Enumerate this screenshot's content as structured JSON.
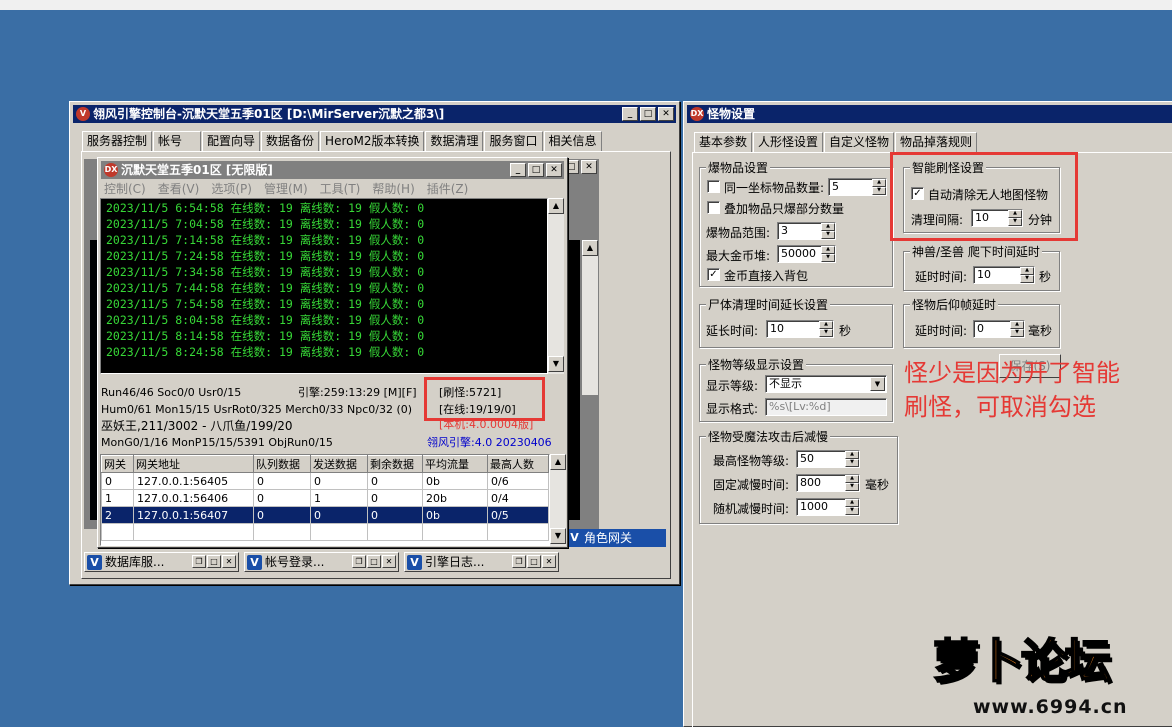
{
  "main_window": {
    "title": "翎风引擎控制台-沉默天堂五季01区 [D:\\MirServer沉默之都3\\]",
    "tabs": [
      "服务器控制",
      "帐号",
      "配置向导",
      "数据备份",
      "HeroM2版本转换",
      "数据清理",
      "服务窗口",
      "相关信息"
    ],
    "selected_tab": "服务窗口"
  },
  "server_window": {
    "title": "沉默天堂五季01区 [无限版]",
    "menu": [
      "控制(C)",
      "查看(V)",
      "选项(P)",
      "管理(M)",
      "工具(T)",
      "帮助(H)",
      "插件(Z)"
    ],
    "log_lines": [
      "2023/11/5 6:54:58 在线数: 19 离线数: 19 假人数: 0",
      "2023/11/5 7:04:58 在线数: 19 离线数: 19 假人数: 0",
      "2023/11/5 7:14:58 在线数: 19 离线数: 19 假人数: 0",
      "2023/11/5 7:24:58 在线数: 19 离线数: 19 假人数: 0",
      "2023/11/5 7:34:58 在线数: 19 离线数: 19 假人数: 0",
      "2023/11/5 7:44:58 在线数: 19 离线数: 19 假人数: 0",
      "2023/11/5 7:54:58 在线数: 19 离线数: 19 假人数: 0",
      "2023/11/5 8:04:58 在线数: 19 离线数: 19 假人数: 0",
      "2023/11/5 8:14:58 在线数: 19 离线数: 19 假人数: 0",
      "2023/11/5 8:24:58 在线数: 19 离线数: 19 假人数: 0"
    ],
    "status": {
      "line1_left": "Run46/46 Soc0/0 Usr0/15",
      "line1_mid": "引擎:259:13:29 [M][F]",
      "refresh": "[刷怪:5721]",
      "line2_left": "Hum0/61 Mon15/15 UsrRot0/325 Merch0/33 Npc0/32 (0)",
      "online": "[在线:19/19/0]",
      "line3_left": "巫妖王,211/3002 - 八爪鱼/199/20",
      "line3_right": "[本机:4.0.0004版]",
      "line4_left": "MonG0/1/16 MonP15/15/5391 ObjRun0/15",
      "version": "翎风引擎:4.0 20230406"
    },
    "gateway_table": {
      "headers": [
        "网关",
        "网关地址",
        "队列数据",
        "发送数据",
        "剩余数据",
        "平均流量",
        "最高人数"
      ],
      "rows": [
        [
          "0",
          "127.0.0.1:56405",
          "0",
          "0",
          "0",
          "0b",
          "0/6"
        ],
        [
          "1",
          "127.0.0.1:56406",
          "0",
          "1",
          "0",
          "20b",
          "0/4"
        ],
        [
          "2",
          "127.0.0.1:56407",
          "0",
          "0",
          "0",
          "0b",
          "0/5"
        ]
      ],
      "selected_row": 2
    }
  },
  "taskbar": {
    "items": [
      "数据库服...",
      "帐号登录...",
      "引擎日志..."
    ],
    "role_gateway": "角色网关"
  },
  "monster_settings": {
    "title": "怪物设置",
    "tabs": [
      "基本参数",
      "人形怪设置",
      "自定义怪物",
      "物品掉落规则"
    ],
    "selected_tab": "基本参数",
    "drop_group": {
      "label": "爆物品设置",
      "same_coord_label": "同一坐标物品数量:",
      "same_coord_checked": false,
      "same_coord_value": "5",
      "stack_only_label": "叠加物品只爆部分数量",
      "stack_only_checked": false,
      "range_label": "爆物品范围:",
      "range_value": "3",
      "max_gold_label": "最大金币堆:",
      "max_gold_value": "50000",
      "gold_to_bag_label": "金币直接入背包",
      "gold_to_bag_checked": true
    },
    "smart_refresh": {
      "label": "智能刷怪设置",
      "auto_clear_label": "自动清除无人地图怪物",
      "auto_clear_checked": true,
      "interval_label": "清理间隔:",
      "interval_value": "10",
      "interval_unit": "分钟"
    },
    "beast_group": {
      "label": "神兽/圣兽 爬下时间延时",
      "delay_label": "延时时间:",
      "delay_value": "10",
      "delay_unit": "秒"
    },
    "corpse_group": {
      "label": "尸体清理时间延长设置",
      "delay_label": "延长时间:",
      "delay_value": "10",
      "delay_unit": "秒"
    },
    "backflip_group": {
      "label": "怪物后仰帧延时",
      "delay_label": "延时时间:",
      "delay_value": "0",
      "delay_unit": "毫秒"
    },
    "save_button": "保存(S)",
    "level_group": {
      "label": "怪物等级显示设置",
      "show_level_label": "显示等级:",
      "show_level_value": "不显示",
      "format_label": "显示格式:",
      "format_value": "%s\\[Lv:%d]"
    },
    "magic_group": {
      "label": "怪物受魔法攻击后减慢",
      "max_level_label": "最高怪物等级:",
      "max_level_value": "50",
      "fixed_label": "固定减慢时间:",
      "fixed_value": "800",
      "fixed_unit": "毫秒",
      "random_label": "随机减慢时间:",
      "random_value": "1000"
    }
  },
  "annotation": {
    "line1": "怪少是因为开了智能",
    "line2": "刷怪，可取消勾选"
  },
  "watermark": {
    "logo": "萝卜论坛",
    "url": "www.6994.cn"
  },
  "colors": {
    "desktop": "#3a6ea5",
    "title_active": "#0a246a",
    "console_text": "#37d837",
    "highlight_red": "#e53935"
  }
}
